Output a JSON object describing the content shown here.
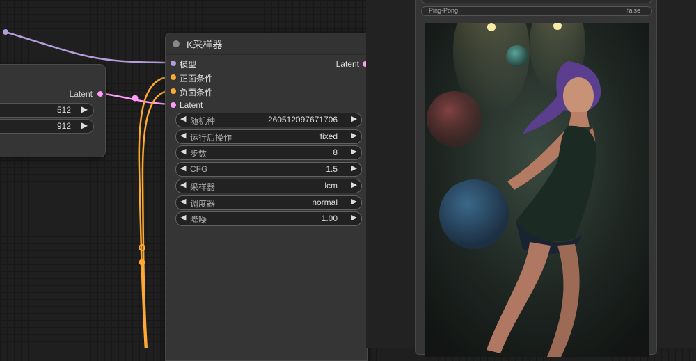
{
  "left_node": {
    "output_label": "Latent",
    "widgets": [
      {
        "value": "512"
      },
      {
        "value": "912"
      }
    ]
  },
  "ksampler": {
    "title": "K采样器",
    "inputs": [
      {
        "label": "模型",
        "color": "#b39ddb"
      },
      {
        "label": "正面条件",
        "color": "#ffa931"
      },
      {
        "label": "负面条件",
        "color": "#ffa931"
      },
      {
        "label": "Latent",
        "color": "#ff9cf9"
      }
    ],
    "output_label": "Latent",
    "widgets": [
      {
        "label": "随机种",
        "value": "260512097671706"
      },
      {
        "label": "运行后操作",
        "value": "fixed"
      },
      {
        "label": "步数",
        "value": "8"
      },
      {
        "label": "CFG",
        "value": "1.5"
      },
      {
        "label": "采样器",
        "value": "lcm"
      },
      {
        "label": "调度器",
        "value": "normal"
      },
      {
        "label": "降噪",
        "value": "1.00"
      }
    ]
  },
  "preview_node": {
    "widgets": [
      {
        "label": "Ping-Pong",
        "value": "false"
      }
    ]
  },
  "icons": {
    "arrow_left": "◀",
    "arrow_right": "▶"
  },
  "colors": {
    "model_wire": "#b39ddb",
    "conditioning_wire": "#ffa931",
    "latent_wire": "#ff9cf9"
  }
}
